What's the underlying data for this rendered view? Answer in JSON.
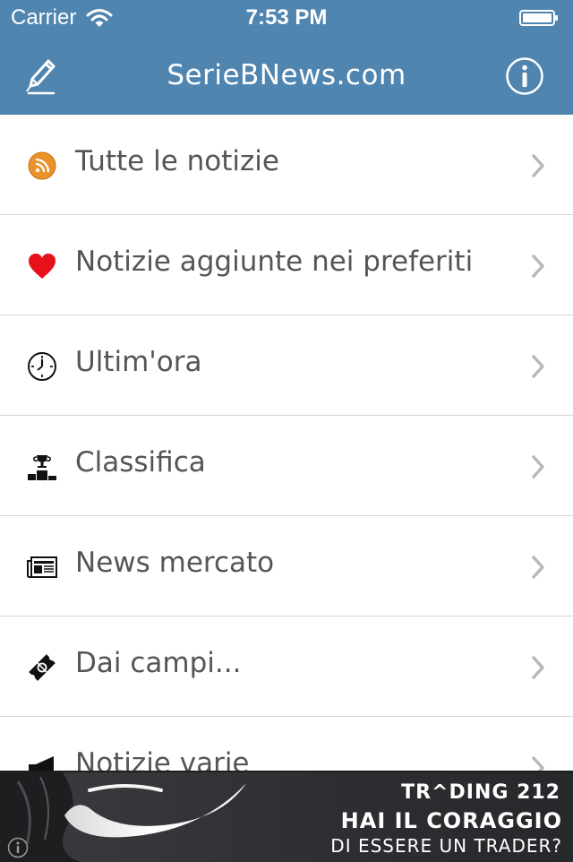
{
  "status_bar": {
    "carrier": "Carrier",
    "time": "7:53 PM"
  },
  "nav": {
    "title": "SerieBNews.com",
    "left_icon": "edit-icon",
    "right_icon": "info-icon"
  },
  "menu": {
    "items": [
      {
        "label": "Tutte le notizie",
        "icon": "rss-icon"
      },
      {
        "label": "Notizie aggiunte nei preferiti",
        "icon": "heart-icon"
      },
      {
        "label": "Ultim'ora",
        "icon": "clock-icon"
      },
      {
        "label": "Classifica",
        "icon": "podium-icon"
      },
      {
        "label": "News mercato",
        "icon": "newspaper-icon"
      },
      {
        "label": "Dai campi...",
        "icon": "ticket-icon"
      },
      {
        "label": "Notizie varie",
        "icon": "megaphone-icon"
      }
    ]
  },
  "ad": {
    "brand": "TR^DING 212",
    "headline": "HAI IL CORAGGIO",
    "subline": "DI ESSERE UN TRADER?"
  },
  "colors": {
    "nav_background": "#5085b0",
    "row_text": "#555555",
    "separator": "#d6d6d6",
    "heart": "#e8111b",
    "rss": "#e8922a"
  }
}
